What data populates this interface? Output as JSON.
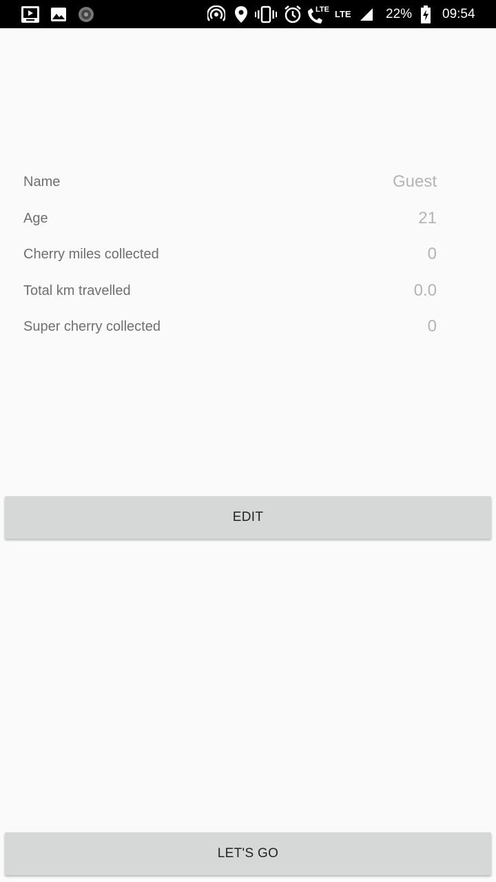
{
  "status_bar": {
    "battery_percent": "22%",
    "time": "09:54",
    "network_1": "LTE",
    "network_2": "LTE",
    "icons": [
      "tv-app-icon",
      "gallery-icon",
      "loading-app-icon",
      "hotspot-icon",
      "location-icon",
      "vibrate-icon",
      "alarm-icon",
      "volte-call-icon",
      "signal-icon",
      "battery-charging-icon"
    ]
  },
  "profile": {
    "rows": [
      {
        "label": "Name",
        "value": "Guest"
      },
      {
        "label": "Age",
        "value": "21"
      },
      {
        "label": "Cherry miles collected",
        "value": "0"
      },
      {
        "label": "Total km travelled",
        "value": "0.0"
      },
      {
        "label": "Super cherry collected",
        "value": "0"
      }
    ]
  },
  "actions": {
    "edit_label": "EDIT",
    "go_label": "LET'S GO"
  }
}
